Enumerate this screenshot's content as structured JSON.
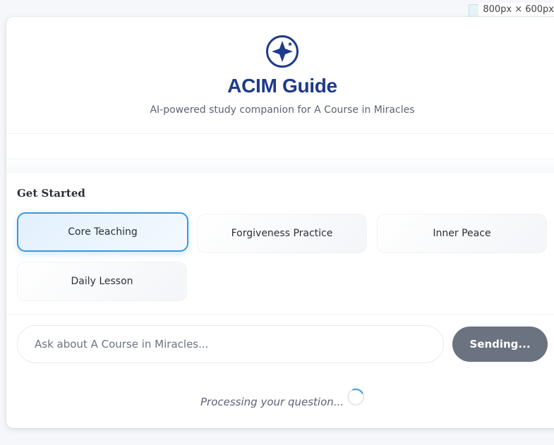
{
  "viewport_label": "800px × 600px",
  "app": {
    "title": "ACIM Guide",
    "subtitle": "AI-powered study companion for A Course in Miracles",
    "logo_icon": "compass-star-icon"
  },
  "get_started": {
    "heading": "Get Started",
    "options": [
      {
        "label": "Core Teaching",
        "active": true
      },
      {
        "label": "Forgiveness Practice",
        "active": false
      },
      {
        "label": "Inner Peace",
        "active": false
      },
      {
        "label": "Daily Lesson",
        "active": false
      }
    ]
  },
  "composer": {
    "placeholder": "Ask about A Course in Miracles...",
    "value": "",
    "send_label": "Sending..."
  },
  "status": {
    "text": "Processing your question..."
  },
  "colors": {
    "brand": "#1e3a8a",
    "accent": "#3b97de",
    "button_disabled": "#6b7280"
  }
}
